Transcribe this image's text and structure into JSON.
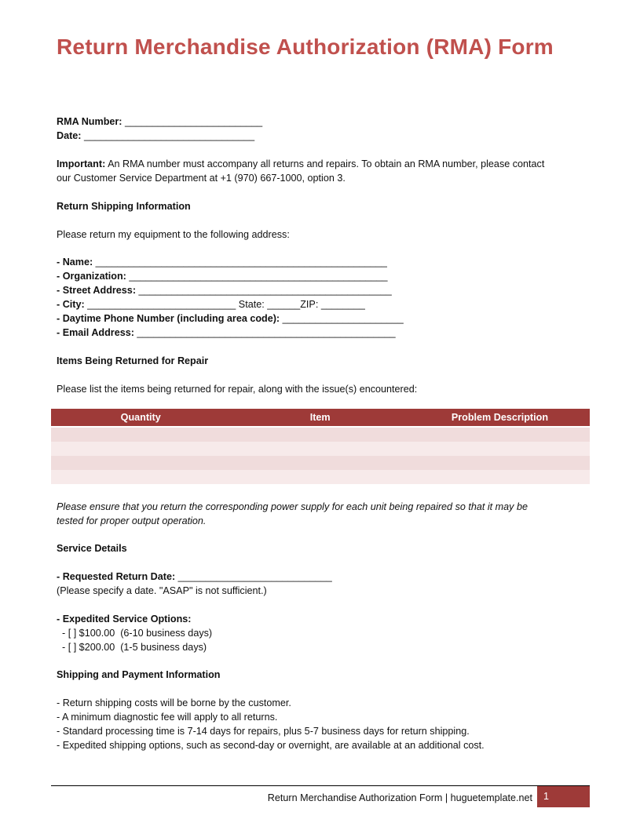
{
  "title": "Return Merchandise Authorization (RMA) Form",
  "header_fields": {
    "rma_number": {
      "label": "RMA Number:",
      "blank": "_________________________"
    },
    "date": {
      "label": "Date:",
      "blank": "_______________________________"
    }
  },
  "important": {
    "label": "Important:",
    "line1": " An RMA number must accompany all  returns and repairs. To obtain an RMA number, please contact",
    "line2": "our Customer Service Department at +1 (970) 667-1000,  option 3."
  },
  "return_shipping": {
    "heading": "Return Shipping Information",
    "intro": "Please return my equipment to the following address:",
    "fields": {
      "name": {
        "label": "- Name:",
        "blank": " _____________________________________________________"
      },
      "organization": {
        "label": "- Organization:",
        "blank": " _______________________________________________"
      },
      "street": {
        "label": "- Street Address:",
        "blank": " ______________________________________________"
      },
      "city": {
        "label": "- City:",
        "blank": " ___________________________"
      },
      "state": {
        "label": " State:",
        "blank": " ______"
      },
      "zip": {
        "label": "ZIP:",
        "blank": " ________"
      },
      "phone": {
        "label": "- Daytime Phone Number (including area code):",
        "blank": " ______________________"
      },
      "email": {
        "label": "- Email Address:",
        "blank": " _______________________________________________"
      }
    }
  },
  "items": {
    "heading": "Items Being Returned for Repair",
    "intro": "Please list the items being returned for repair, along with the issue(s) encountered:",
    "columns": [
      "Quantity",
      "Item",
      "Problem Description"
    ],
    "rows": [
      [
        "",
        "",
        ""
      ],
      [
        "",
        "",
        ""
      ],
      [
        "",
        "",
        ""
      ],
      [
        "",
        "",
        ""
      ]
    ],
    "note_line1": "Please ensure that you return the corresponding power supply for each unit being repaired so that it  may be",
    "note_line2": "tested for proper output operation."
  },
  "service": {
    "heading": "Service Details",
    "return_date_label": "- Requested Return Date:",
    "return_date_blank": " ____________________________",
    "return_date_note": "(Please specify a date. \"ASAP\" is not sufficient.)",
    "expedited_label": "- Expedited Service Options:",
    "options": [
      "  - [ ] $100.00  (6-10 business days)",
      "  - [ ] $200.00  (1-5 business days)"
    ]
  },
  "shipping_payment": {
    "heading": "Shipping and Payment Information",
    "bullets": [
      "- Return shipping costs will be borne by the customer.",
      "- A minimum diagnostic fee will apply to all returns.",
      "- Standard processing time is 7-14  days for repairs, plus 5-7 business days for return shipping.",
      "- Expedited shipping options, such as second-day or overnight, are available at an additional cost."
    ]
  },
  "footer": {
    "text": "Return Merchandise Authorization Form | huguetemplate.net",
    "page_number": "1"
  },
  "colors": {
    "title": "#c0504d",
    "table_header": "#9e3a38",
    "row_odd": "#f0dcdc",
    "row_even": "#f7eaea"
  }
}
